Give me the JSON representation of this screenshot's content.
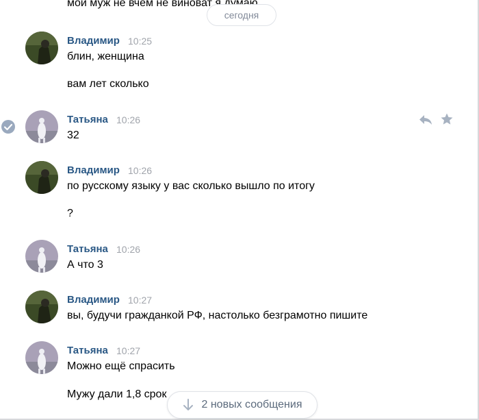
{
  "colors": {
    "name": "#2a5885",
    "time": "#a0a4ab",
    "pill_text": "#828a99",
    "icon": "#a7b2c1",
    "check": "#9aa9be"
  },
  "top_fragment": "мой муж не вчем не виноват я думаю",
  "date_divider": "сегодня",
  "messages": [
    {
      "sender": "Владимир",
      "time": "10:25",
      "avatar": "vladimir-avatar",
      "texts": [
        "блин, женщина",
        "вам лет сколько"
      ]
    },
    {
      "sender": "Татьяна",
      "time": "10:26",
      "avatar": "tatyana-avatar",
      "texts": [
        "32"
      ]
    },
    {
      "sender": "Владимир",
      "time": "10:26",
      "avatar": "vladimir-avatar",
      "texts": [
        "по русскому языку у вас сколько вышло по итогу",
        "?"
      ]
    },
    {
      "sender": "Татьяна",
      "time": "10:26",
      "avatar": "tatyana-avatar",
      "texts": [
        "А что 3"
      ]
    },
    {
      "sender": "Владимир",
      "time": "10:27",
      "avatar": "vladimir-avatar",
      "texts": [
        "вы, будучи гражданкой РФ, настолько безграмотно пишите"
      ]
    },
    {
      "sender": "Татьяна",
      "time": "10:27",
      "avatar": "tatyana-avatar",
      "texts": [
        "Можно ещё спрасить",
        "Мужу дали 1,8 срок"
      ]
    }
  ],
  "hover_actions": {
    "reply": "reply-icon",
    "favorite": "star-icon",
    "selected": "check-circle-icon"
  },
  "new_messages_button": "2 новых сообщения"
}
